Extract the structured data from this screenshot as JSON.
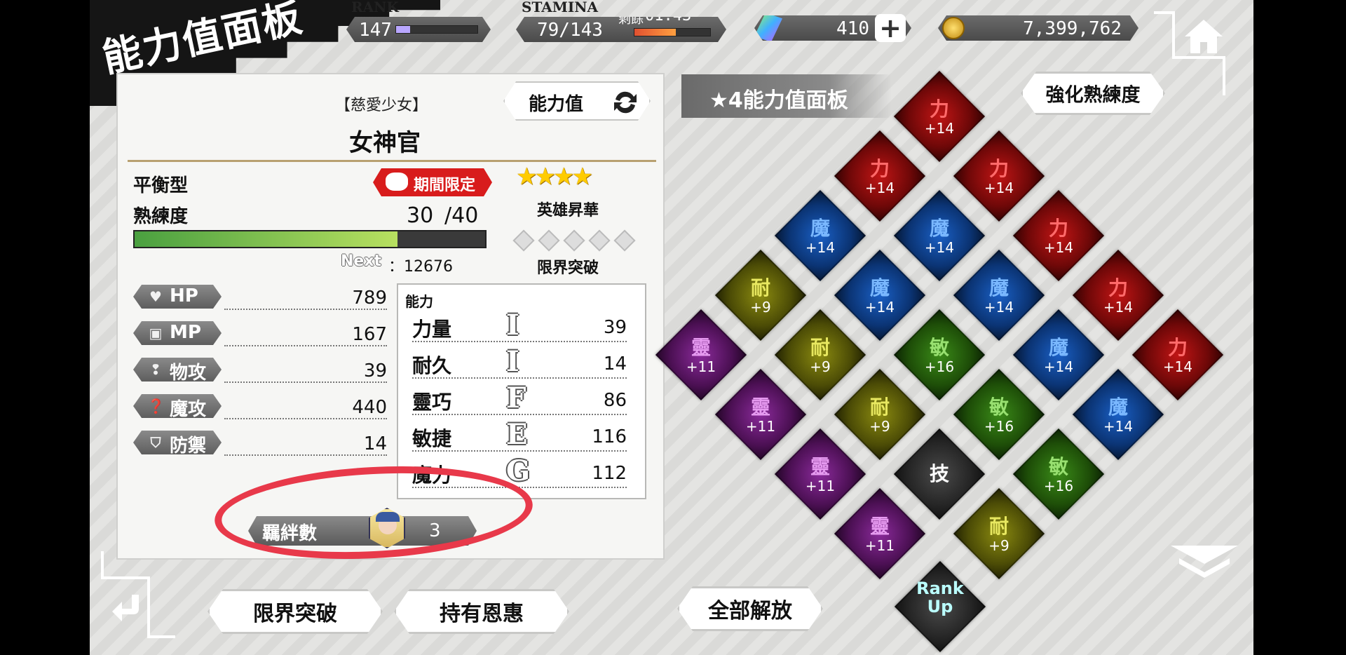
{
  "header": {
    "page_title": "能力值面板",
    "rank_label": "RANK",
    "rank_value": "147",
    "rank_progress": 0.17,
    "stamina_label": "STAMINA",
    "stamina_value": "79/143",
    "stamina_timer_label": "剩餘",
    "stamina_timer": "01:43",
    "stamina_progress": 0.55,
    "gems": "410",
    "gold": "7,399,762",
    "plus_symbol": "+"
  },
  "character": {
    "epithet": "【慈愛少女】",
    "name": "女神官",
    "stat_toggle_label": "能力值",
    "type": "平衡型",
    "limited_badge": "期間限定",
    "stars": "★★★★",
    "hero_label": "英雄昇華",
    "proficiency_label": "熟練度",
    "proficiency_value": "30",
    "proficiency_max": "/40",
    "proficiency_progress": 0.75,
    "next_label": "Next",
    "next_value": "：12676",
    "limit_break_label": "限界突破",
    "limit_break_filled": 0,
    "limit_break_total": 5
  },
  "stats": [
    {
      "label": "HP",
      "value": "789",
      "icon": "heart-icon"
    },
    {
      "label": "MP",
      "value": "167",
      "icon": "book-icon"
    },
    {
      "label": "物攻",
      "value": "39",
      "icon": "sword-icon"
    },
    {
      "label": "魔攻",
      "value": "440",
      "icon": "magic-icon"
    },
    {
      "label": "防禦",
      "value": "14",
      "icon": "shield-icon"
    }
  ],
  "abilities": {
    "title": "能力",
    "rows": [
      {
        "name": "力量",
        "rank": "I",
        "value": "39"
      },
      {
        "name": "耐久",
        "rank": "I",
        "value": "14"
      },
      {
        "name": "靈巧",
        "rank": "F",
        "value": "86"
      },
      {
        "name": "敏捷",
        "rank": "E",
        "value": "116"
      },
      {
        "name": "魔力",
        "rank": "G",
        "value": "112"
      }
    ]
  },
  "bond": {
    "label": "羈絆數",
    "value": "3"
  },
  "buttons": {
    "limit_break": "限界突破",
    "blessings": "持有恩惠",
    "unlock_all": "全部解放",
    "enhance": "強化熟練度"
  },
  "board": {
    "title": "★4能力值面板",
    "tiles": [
      {
        "row": 0,
        "col": 0,
        "label": "力",
        "value": "+14",
        "color": "red"
      },
      {
        "row": 0,
        "col": 1,
        "label": "力",
        "value": "+14",
        "color": "red"
      },
      {
        "row": 0,
        "col": 2,
        "label": "力",
        "value": "+14",
        "color": "red"
      },
      {
        "row": 0,
        "col": 3,
        "label": "力",
        "value": "+14",
        "color": "red"
      },
      {
        "row": 0,
        "col": 4,
        "label": "力",
        "value": "+14",
        "color": "red"
      },
      {
        "row": 1,
        "col": 0,
        "label": "力",
        "value": "+14",
        "color": "red"
      },
      {
        "row": 1,
        "col": 1,
        "label": "魔",
        "value": "+14",
        "color": "blue"
      },
      {
        "row": 1,
        "col": 2,
        "label": "魔",
        "value": "+14",
        "color": "blue"
      },
      {
        "row": 1,
        "col": 3,
        "label": "魔",
        "value": "+14",
        "color": "blue"
      },
      {
        "row": 1,
        "col": 4,
        "label": "魔",
        "value": "+14",
        "color": "blue"
      },
      {
        "row": 2,
        "col": 0,
        "label": "魔",
        "value": "+14",
        "color": "blue"
      },
      {
        "row": 2,
        "col": 1,
        "label": "魔",
        "value": "+14",
        "color": "blue"
      },
      {
        "row": 2,
        "col": 2,
        "label": "敏",
        "value": "+16",
        "color": "green"
      },
      {
        "row": 2,
        "col": 3,
        "label": "敏",
        "value": "+16",
        "color": "green"
      },
      {
        "row": 2,
        "col": 4,
        "label": "敏",
        "value": "+16",
        "color": "green"
      },
      {
        "row": 3,
        "col": 0,
        "label": "耐",
        "value": "+9",
        "color": "yellow"
      },
      {
        "row": 3,
        "col": 1,
        "label": "耐",
        "value": "+9",
        "color": "yellow"
      },
      {
        "row": 3,
        "col": 2,
        "label": "耐",
        "value": "+9",
        "color": "yellow"
      },
      {
        "row": 3,
        "col": 3,
        "label": "技",
        "value": "",
        "color": "dark"
      },
      {
        "row": 3,
        "col": 4,
        "label": "耐",
        "value": "+9",
        "color": "yellow"
      },
      {
        "row": 4,
        "col": 0,
        "label": "靈",
        "value": "+11",
        "color": "purple"
      },
      {
        "row": 4,
        "col": 1,
        "label": "靈",
        "value": "+11",
        "color": "purple"
      },
      {
        "row": 4,
        "col": 2,
        "label": "靈",
        "value": "+11",
        "color": "purple"
      },
      {
        "row": 4,
        "col": 3,
        "label": "靈",
        "value": "+11",
        "color": "purple"
      }
    ],
    "rank_up_label": "Rank Up"
  }
}
